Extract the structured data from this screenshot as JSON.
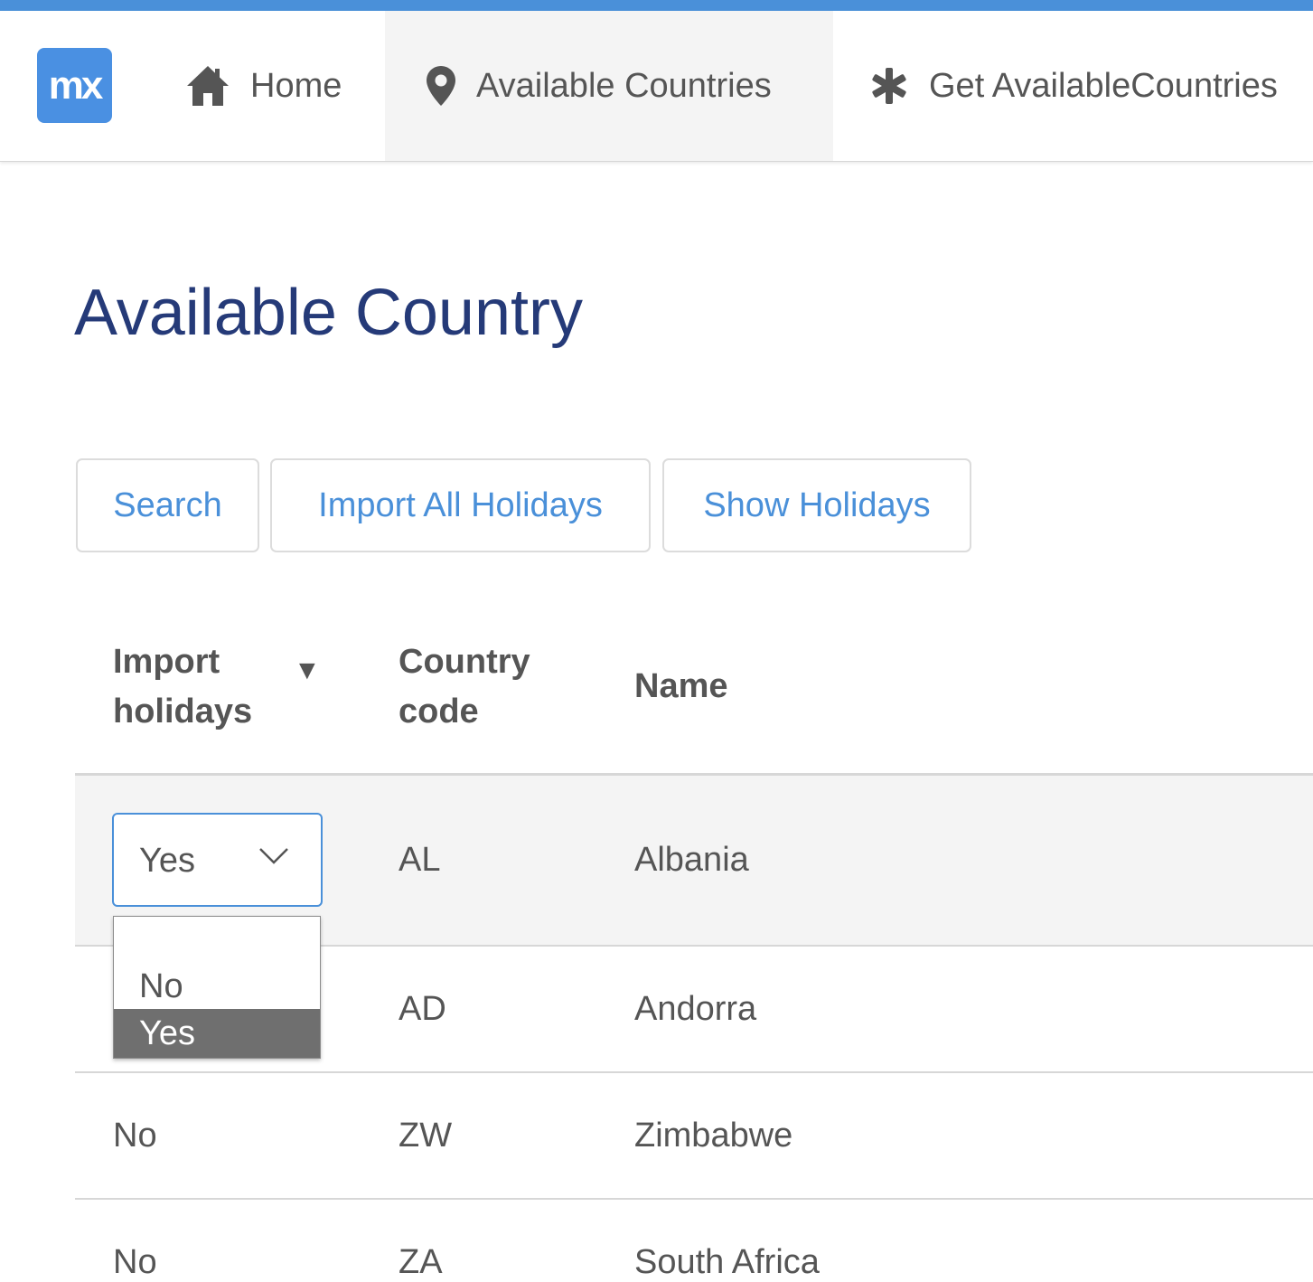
{
  "app": {
    "logo_text": "mx",
    "accent_color": "#4a90d9",
    "title_color": "#253a78"
  },
  "nav": {
    "items": [
      {
        "label": "Home",
        "icon": "home-icon"
      },
      {
        "label": "Available Countries",
        "icon": "map-marker-icon",
        "active": true
      },
      {
        "label": "Get AvailableCountries",
        "icon": "asterisk-icon"
      }
    ]
  },
  "page": {
    "title": "Available Country"
  },
  "toolbar": {
    "search_label": "Search",
    "import_label": "Import All Holidays",
    "show_label": "Show Holidays"
  },
  "table": {
    "headers": {
      "import": "Import holidays",
      "code": "Country code",
      "name": "Name"
    },
    "sort_indicator": "▼",
    "rows": [
      {
        "import": "Yes",
        "code": "AL",
        "name": "Albania"
      },
      {
        "import": "",
        "code": "AD",
        "name": "Andorra"
      },
      {
        "import": "No",
        "code": "ZW",
        "name": "Zimbabwe"
      },
      {
        "import": "No",
        "code": "ZA",
        "name": "South Africa"
      }
    ]
  },
  "dropdown": {
    "current": "Yes",
    "options": [
      "No",
      "Yes"
    ],
    "highlighted": "Yes"
  }
}
